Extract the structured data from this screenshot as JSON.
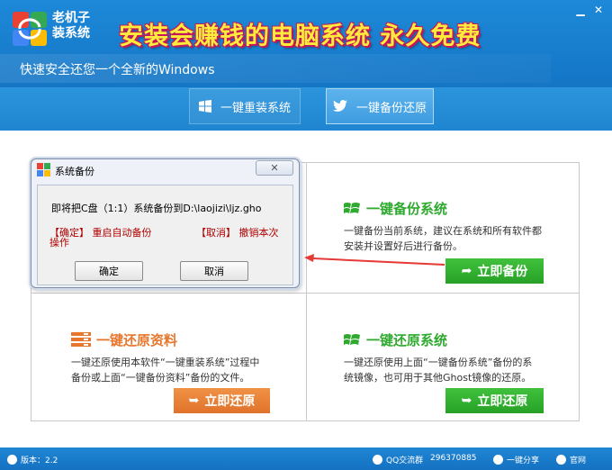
{
  "app": {
    "name": "老机子装系统",
    "slogan": "安装会赚钱的电脑系统 永久免费",
    "subtitle": "快速安全还您一个全新的Windows"
  },
  "window_controls": {
    "minimize": "▁",
    "close": "✕"
  },
  "tabs": [
    {
      "label": "一键重装系统",
      "icon": "windows-icon"
    },
    {
      "label": "一键备份还原",
      "icon": "twitter-bird-icon",
      "active": true
    }
  ],
  "panels": {
    "backup_system": {
      "title": "一键备份系统",
      "desc_line1": "一键备份当前系统，建议在系统和所有软件都",
      "desc_line2": "安装并设置好后进行备份。",
      "button": "立即备份"
    },
    "restore_data": {
      "title": "一键还原资料",
      "desc_line1": "一键还原使用本软件“一键重装系统”过程中",
      "desc_line2": "备份或上面“一键备份资料”备份的文件。",
      "button": "立即还原"
    },
    "restore_system": {
      "title": "一键还原系统",
      "desc_line1": "一键还原使用上面“一键备份系统”备份的系",
      "desc_line2": "统镜像，也可用于其他Ghost镜像的还原。",
      "button": "立即还原"
    }
  },
  "dialog": {
    "title": "系统备份",
    "close": "✕",
    "message": "即将把C盘（1:1）系统备份到D:\\laojizi\\ljz.gho",
    "confirm_hint_line1": "【确定】 重启自动备份",
    "confirm_hint_line2": "操作",
    "cancel_hint": "【取消】 撤销本次",
    "ok_button": "确定",
    "cancel_button": "取消"
  },
  "statusbar": {
    "version": "版本：2.2",
    "qq_group": "QQ交流群",
    "qq_number": "296370885",
    "share": "一键分享",
    "website": "官网"
  },
  "colors": {
    "header_blue": "#1577c7",
    "green_accent": "#2faa2f",
    "orange_accent": "#e8762c",
    "dialog_red_text": "#b00000"
  }
}
